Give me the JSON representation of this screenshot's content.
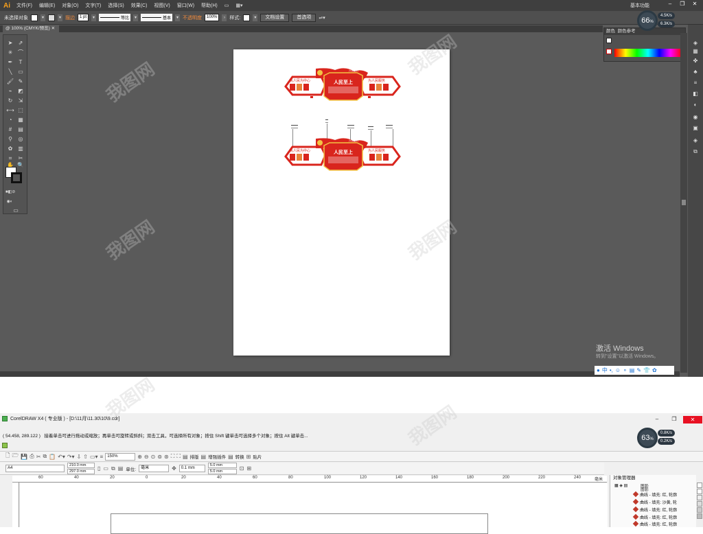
{
  "illustrator": {
    "logo": "Ai",
    "menus": [
      "文件(F)",
      "编辑(E)",
      "对象(O)",
      "文字(T)",
      "选择(S)",
      "效果(C)",
      "视图(V)",
      "窗口(W)",
      "帮助(H)"
    ],
    "workspace": "基本功能",
    "control_bar": {
      "selection": "未选择对象",
      "stroke_label": "描边",
      "stroke_weight": "1 pt",
      "stroke_profile": "等比",
      "brush": "基本",
      "opacity_label": "不透明度",
      "opacity_value": "100%",
      "style_label": "样式:",
      "doc_setup_button": "文档设置",
      "prefs_button": "首选项"
    },
    "document_tab": "@ 100% (CMYK/预览)",
    "color_panel": {
      "tabs": [
        "颜色",
        "颜色参考"
      ]
    },
    "system_meter": {
      "percent": "66",
      "unit": "%",
      "up": "4.5",
      "down": "6.3",
      "rate_unit": "K/s"
    },
    "activate": {
      "line1": "激活 Windows",
      "line2": "转到\"设置\"以激活 Windows。"
    }
  },
  "artboard": {
    "wall": {
      "left_slogan": "执人民为中心",
      "center_title": "人民至上",
      "right_slogan": "为人民服务",
      "flag_text": "六项之约"
    }
  },
  "coreldraw": {
    "title": "CorelDRAW X4 ( 专业版 ) - [D:\\11月\\11.30\\10\\9.cdr]",
    "status": "( 54.458, 289.122 )",
    "hint": "接着单击可进行拖动或缩放；再单击可旋转或斜斜；双击工具，可选择所有对象；按住 Shift 键单击可选择多个对象；按住 Alt 键单击...",
    "toolbar": {
      "zoom": "150%",
      "layout": "排版",
      "enhance": "增强插件",
      "convert": "转换",
      "paste": "贴片"
    },
    "property_bar": {
      "paper": "A4",
      "width": "210.0 mm",
      "height": "297.0 mm",
      "unit_label": "单位:",
      "unit": "毫米",
      "nudge": "0.1 mm",
      "dup_x": "5.0 mm",
      "dup_y": "5.0 mm"
    },
    "ruler_labels": [
      "60",
      "40",
      "20",
      "0",
      "20",
      "40",
      "60",
      "80",
      "100",
      "120",
      "140",
      "160",
      "180",
      "200",
      "220",
      "240",
      "260"
    ],
    "ruler_unit": "毫米",
    "object_manager": {
      "title": "对象管理器",
      "layer_labels": [
        "图层:",
        "图层:"
      ],
      "items": [
        "曲线 - 填充: 红, 轮廓",
        "曲线 - 填充: 沙黄, 轮",
        "曲线 - 填充: 红, 轮廓",
        "曲线 - 填充: 红, 轮廓",
        "曲线 - 填充: 红, 轮廓"
      ]
    },
    "system_meter": {
      "percent": "63",
      "unit": "%",
      "up": "0.8",
      "down": "0.2",
      "rate_unit": "K/s"
    }
  },
  "watermark": "我图网",
  "colors": {
    "ai_bg": "#5a5a5a",
    "ai_accent": "#f9a01b",
    "wall_red": "#d9251d",
    "wall_gold": "#f3c343",
    "close_red": "#e81123"
  }
}
